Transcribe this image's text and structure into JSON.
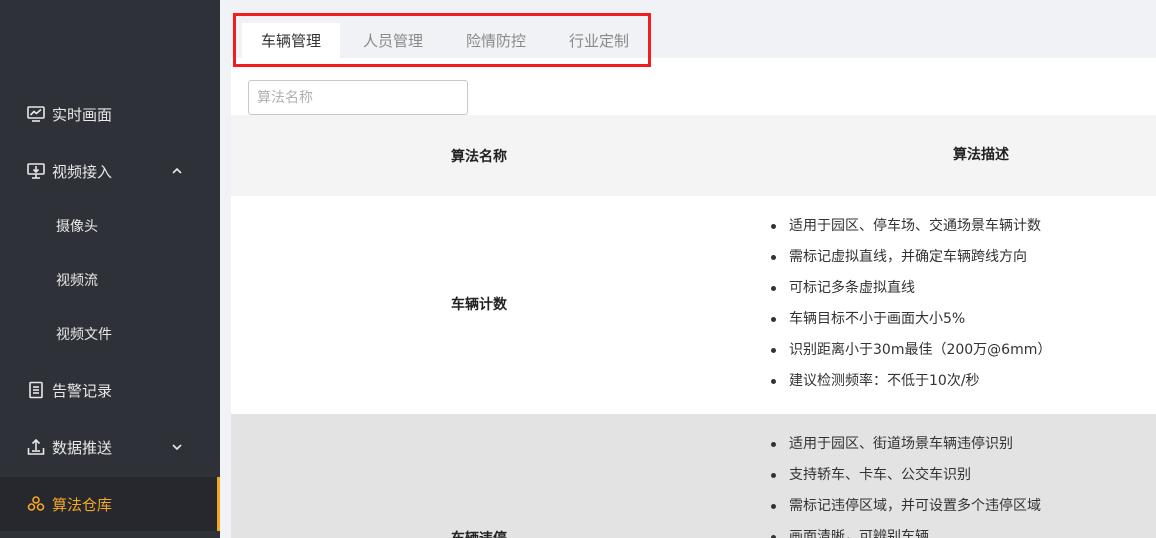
{
  "sidebar": {
    "items": [
      {
        "label": "实时画面",
        "icon": "monitor-chart-icon"
      },
      {
        "label": "视频接入",
        "icon": "video-input-icon",
        "expanded": true,
        "children": [
          {
            "label": "摄像头"
          },
          {
            "label": "视频流"
          },
          {
            "label": "视频文件"
          }
        ]
      },
      {
        "label": "告警记录",
        "icon": "list-document-icon"
      },
      {
        "label": "数据推送",
        "icon": "upload-tray-icon",
        "expanded": false
      },
      {
        "label": "算法仓库",
        "icon": "cube-cluster-icon",
        "active": true
      }
    ],
    "active_color": "#f5a623"
  },
  "tabs": [
    {
      "label": "车辆管理",
      "active": true
    },
    {
      "label": "人员管理"
    },
    {
      "label": "险情防控"
    },
    {
      "label": "行业定制"
    }
  ],
  "search": {
    "placeholder": "算法名称",
    "value": ""
  },
  "table": {
    "headers": [
      "算法名称",
      "算法描述"
    ],
    "rows": [
      {
        "name": "车辆计数",
        "desc": [
          "适用于园区、停车场、交通场景车辆计数",
          "需标记虚拟直线，并确定车辆跨线方向",
          "可标记多条虚拟直线",
          "车辆目标不小于画面大小5%",
          "识别距离小于30m最佳（200万@6mm）",
          "建议检测频率：不低于10次/秒"
        ]
      },
      {
        "name": "车辆违停",
        "desc": [
          "适用于园区、街道场景车辆违停识别",
          "支持轿车、卡车、公交车识别",
          "需标记违停区域，并可设置多个违停区域",
          "画面清晰，可辨别车辆"
        ]
      }
    ]
  }
}
